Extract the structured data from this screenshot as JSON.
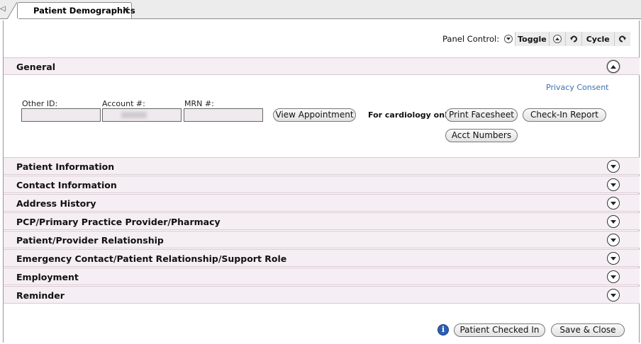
{
  "tab": {
    "label": "Patient Demographics",
    "close_glyph": "✕",
    "scroll_glyph": "◁"
  },
  "panel_control": {
    "label": "Panel Control:",
    "toggle": "Toggle",
    "cycle": "Cycle"
  },
  "general": {
    "title": "General",
    "privacy_link": "Privacy Consent",
    "fields": {
      "other_id_label": "Other ID:",
      "account_label": "Account #:",
      "mrn_label": "MRN #:"
    },
    "view_appointment": "View Appointment",
    "cardiology_label": "For cardiology only:",
    "print_facesheet": "Print Facesheet",
    "check_in_report": "Check-In Report",
    "acct_numbers": "Acct Numbers"
  },
  "sections": [
    "Patient Information",
    "Contact Information",
    "Address History",
    "PCP/Primary Practice Provider/Pharmacy",
    "Patient/Provider Relationship",
    "Emergency Contact/Patient Relationship/Support Role",
    "Employment",
    "Reminder"
  ],
  "footer": {
    "info_glyph": "i",
    "patient_checked_in": "Patient Checked In",
    "save_close": "Save & Close"
  },
  "colors": {
    "section_bg": "#f5eef3",
    "link": "#3a6fb0",
    "info_icon": "#2d5fb5"
  },
  "icons": {
    "expand": "chevron-down-circle-icon",
    "collapse": "chevron-up-circle-icon",
    "info": "info-icon"
  }
}
